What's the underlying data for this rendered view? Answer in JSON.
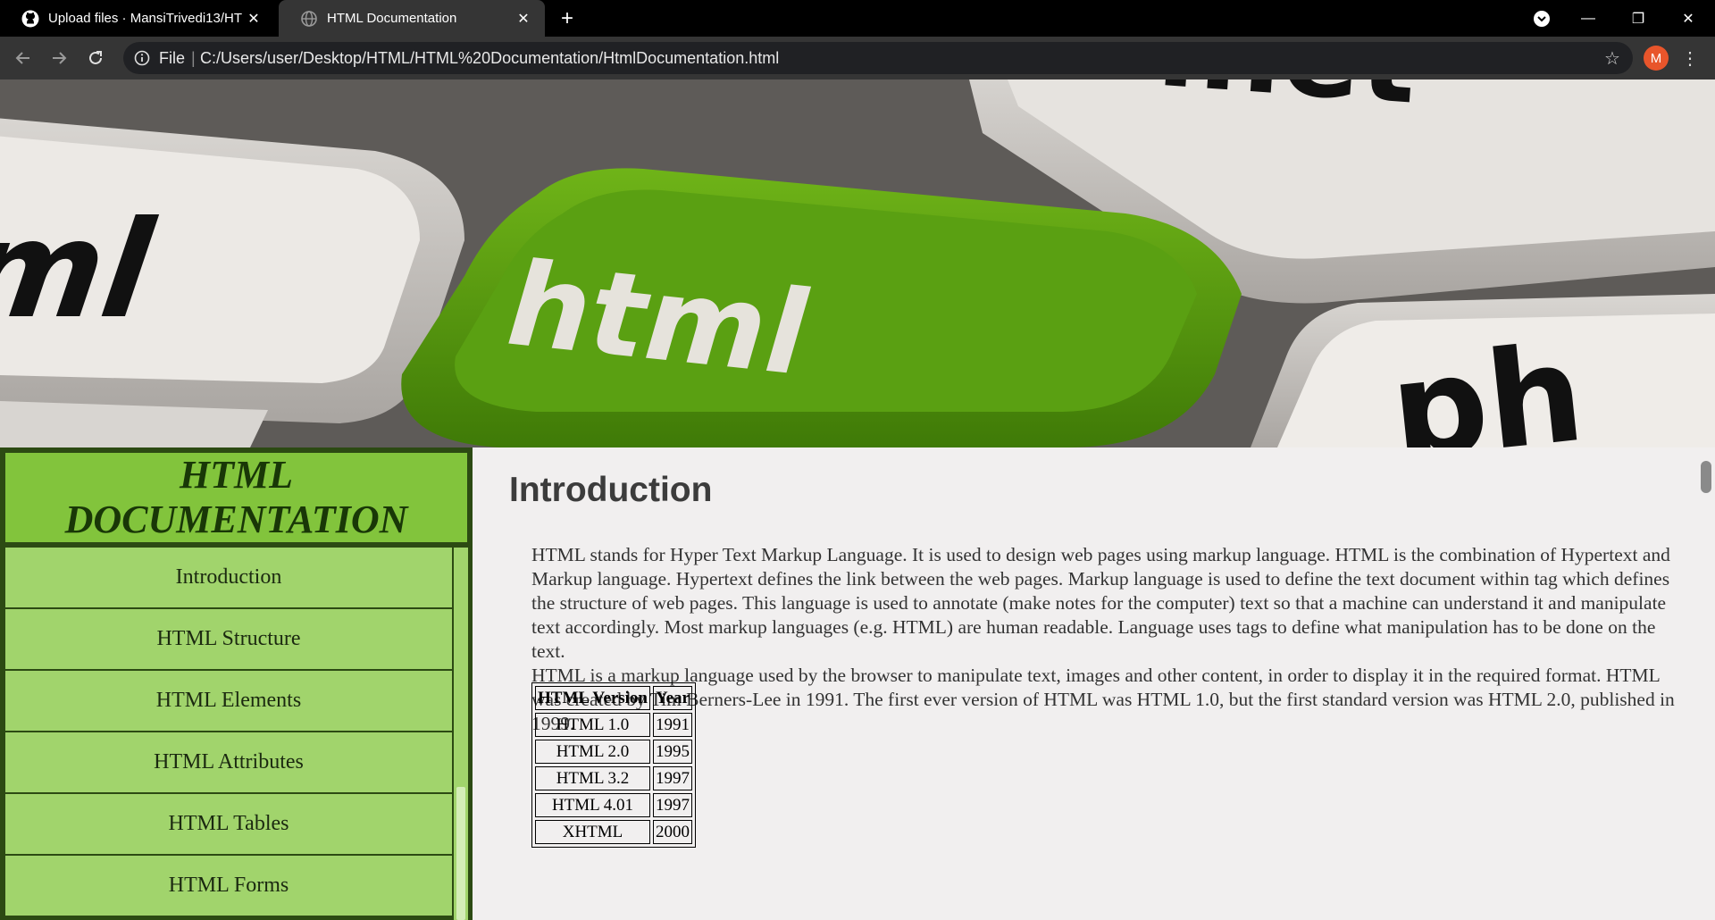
{
  "browser": {
    "tabs": [
      {
        "title": "Upload files · MansiTrivedi13/HTML",
        "icon": "github-icon",
        "active": false
      },
      {
        "title": "HTML Documentation",
        "icon": "globe-icon",
        "active": true
      }
    ],
    "new_tab": "+",
    "window_controls": {
      "minimize": "—",
      "restore": "❐",
      "close": "✕"
    },
    "address": {
      "file_label": "File",
      "separator": "|",
      "url": "C:/Users/user/Desktop/HTML/HTML%20Documentation/HtmlDocumentation.html"
    },
    "profile_initial": "M"
  },
  "banner": {
    "key_labels": [
      "ml",
      "html",
      ".net",
      "ph"
    ],
    "colors": {
      "green_key": "#5a9e0e",
      "grey_key": "#d9d6d2"
    }
  },
  "sidebar": {
    "heading": [
      "HTML",
      "DOCUMENTATION"
    ],
    "items": [
      {
        "label": "Introduction"
      },
      {
        "label": "HTML Structure"
      },
      {
        "label": "HTML Elements"
      },
      {
        "label": "HTML Attributes"
      },
      {
        "label": "HTML Tables"
      },
      {
        "label": "HTML Forms"
      }
    ]
  },
  "main": {
    "heading": "Introduction",
    "paragraphs": [
      "HTML stands for Hyper Text Markup Language. It is used to design web pages using markup language. HTML is the combination of Hypertext and Markup language. Hypertext defines the link between the web pages. Markup language is used to define the text document within tag which defines the structure of web pages. This language is used to annotate (make notes for the computer) text so that a machine can understand it and manipulate text accordingly. Most markup languages (e.g. HTML) are human readable. Language uses tags to define what manipulation has to be done on the text.",
      "HTML is a markup language used by the browser to manipulate text, images and other content, in order to display it in the required format. HTML was created by Tim Berners-Lee in 1991. The first ever version of HTML was HTML 1.0, but the first standard version was HTML 2.0, published in 1999."
    ],
    "table": {
      "headers": [
        "HTML Version",
        "Year"
      ],
      "rows": [
        [
          "HTML 1.0",
          "1991"
        ],
        [
          "HTML 2.0",
          "1995"
        ],
        [
          "HTML 3.2",
          "1997"
        ],
        [
          "HTML 4.01",
          "1997"
        ],
        [
          "XHTML",
          "2000"
        ]
      ]
    }
  }
}
